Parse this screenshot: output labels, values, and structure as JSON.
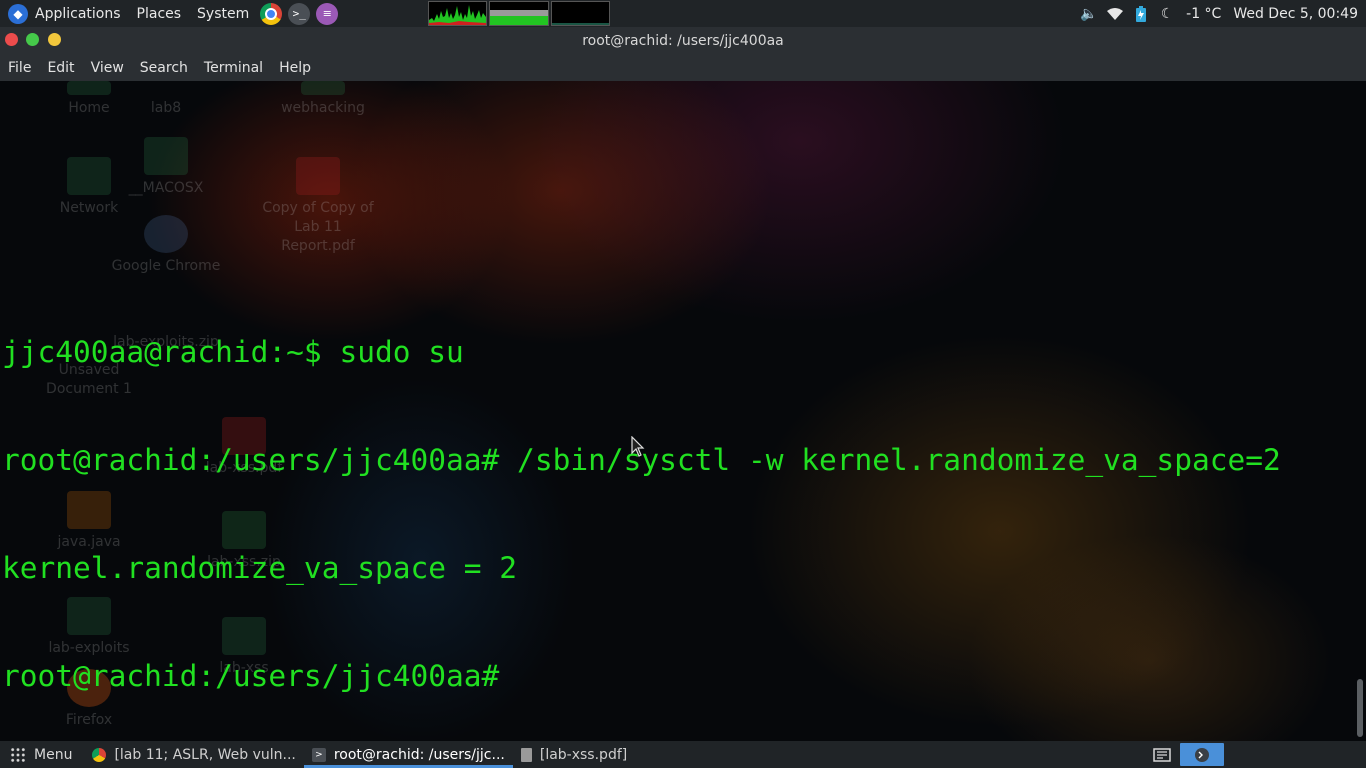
{
  "top_panel": {
    "applications_label": "Applications",
    "places_label": "Places",
    "system_label": "System",
    "launchers": [
      "google-chrome",
      "terminal",
      "text-editor"
    ],
    "weather": "-1 °C",
    "clock": "Wed Dec  5, 00:49",
    "tray_icons": [
      "volume-icon",
      "wifi-icon",
      "battery-icon",
      "moon-icon"
    ]
  },
  "window": {
    "title": "root@rachid: /users/jjc400aa"
  },
  "menu_bar": {
    "items": [
      "File",
      "Edit",
      "View",
      "Search",
      "Terminal",
      "Help"
    ]
  },
  "terminal": {
    "lines": [
      "jjc400aa@rachid:~$ sudo su",
      "root@rachid:/users/jjc400aa# /sbin/sysctl -w kernel.randomize_va_space=2",
      "kernel.randomize_va_space = 2",
      "root@rachid:/users/jjc400aa#"
    ],
    "text_color": "#21e021"
  },
  "desktop_icons": [
    {
      "label": "Home"
    },
    {
      "label": "lab8"
    },
    {
      "label": "webhacking"
    },
    {
      "label": "Network"
    },
    {
      "label": "__MACOSX"
    },
    {
      "label": "Copy of Copy of Lab 11 Report.pdf"
    },
    {
      "label": "Google Chrome"
    },
    {
      "label": "lab-exploits.zip"
    },
    {
      "label": "Unsaved Document 1"
    },
    {
      "label": "lab-xss.pdf"
    },
    {
      "label": "java.java"
    },
    {
      "label": "lab-xss.zip"
    },
    {
      "label": "lab-exploits"
    },
    {
      "label": "lab-xss"
    },
    {
      "label": "Firefox"
    }
  ],
  "bottom_panel": {
    "menu_label": "Menu",
    "tasks": [
      {
        "label": "[lab 11; ASLR, Web vuln...",
        "icon": "chrome-icon",
        "active": false
      },
      {
        "label": "root@rachid: /users/jjc...",
        "icon": "terminal-icon",
        "active": true
      },
      {
        "label": "[lab-xss.pdf]",
        "icon": "document-icon",
        "active": false
      }
    ]
  },
  "colors": {
    "panel_bg": "#202427",
    "titlebar_bg": "#2b2f33",
    "accent": "#4a90d9"
  }
}
